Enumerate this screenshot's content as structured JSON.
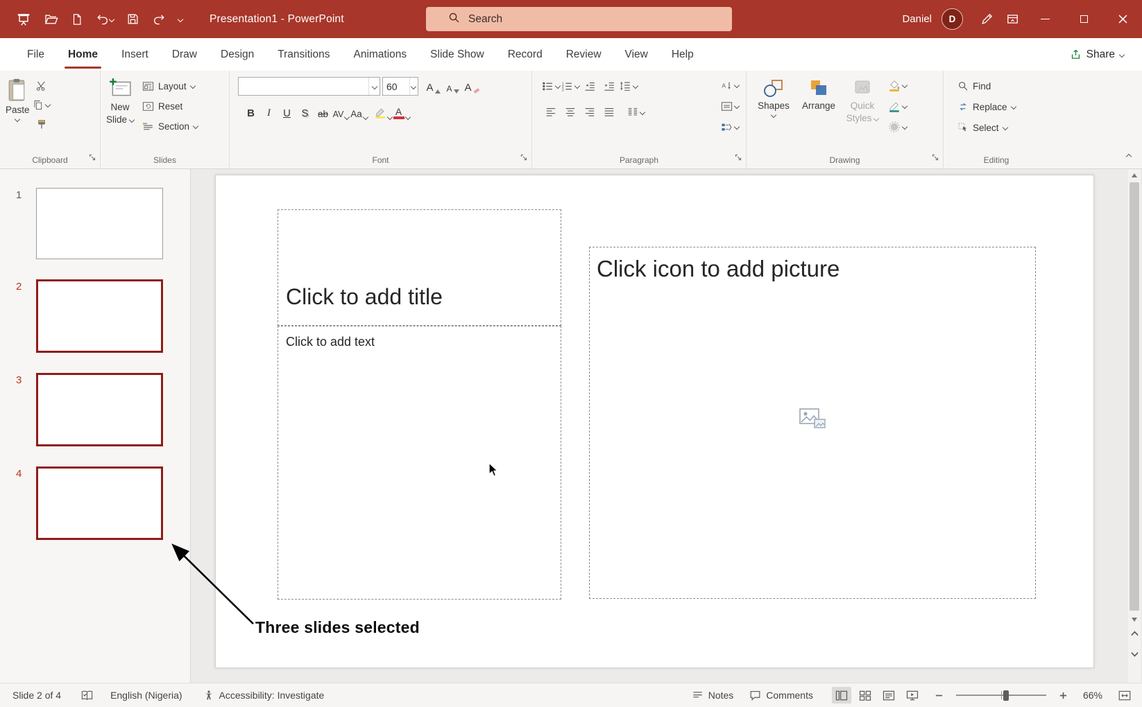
{
  "titlebar": {
    "title": "Presentation1 - PowerPoint",
    "search_placeholder": "Search",
    "user_name": "Daniel",
    "user_initial": "D"
  },
  "tabs": {
    "items": [
      {
        "label": "File"
      },
      {
        "label": "Home"
      },
      {
        "label": "Insert"
      },
      {
        "label": "Draw"
      },
      {
        "label": "Design"
      },
      {
        "label": "Transitions"
      },
      {
        "label": "Animations"
      },
      {
        "label": "Slide Show"
      },
      {
        "label": "Record"
      },
      {
        "label": "Review"
      },
      {
        "label": "View"
      },
      {
        "label": "Help"
      }
    ],
    "share_label": "Share"
  },
  "ribbon": {
    "clipboard": {
      "group_label": "Clipboard",
      "paste_label": "Paste"
    },
    "slides": {
      "group_label": "Slides",
      "new_slide_line1": "New",
      "new_slide_line2": "Slide",
      "layout_label": "Layout",
      "reset_label": "Reset",
      "section_label": "Section"
    },
    "font": {
      "group_label": "Font",
      "font_name_value": "",
      "font_size_value": "60",
      "grow_font_glyph": "A",
      "shrink_font_glyph": "A",
      "clear_format_glyph": "A",
      "bold_glyph": "B",
      "italic_glyph": "I",
      "underline_glyph": "U",
      "shadow_glyph": "S",
      "strikethrough_glyph": "ab",
      "char_spacing_glyph": "AV",
      "change_case_glyph": "Aa",
      "font_color_glyph": "A"
    },
    "paragraph": {
      "group_label": "Paragraph"
    },
    "drawing": {
      "group_label": "Drawing",
      "shapes_label": "Shapes",
      "arrange_label": "Arrange",
      "quick_styles_line1": "Quick",
      "quick_styles_line2": "Styles"
    },
    "editing": {
      "group_label": "Editing",
      "find_label": "Find",
      "replace_label": "Replace",
      "select_label": "Select"
    }
  },
  "slide_panel": {
    "slides": [
      {
        "number": "1",
        "selected": false
      },
      {
        "number": "2",
        "selected": true
      },
      {
        "number": "3",
        "selected": true
      },
      {
        "number": "4",
        "selected": true
      }
    ]
  },
  "annotation": {
    "label": "Three slides selected"
  },
  "canvas": {
    "title_placeholder": "Click to add title",
    "body_placeholder": "Click to add text",
    "picture_placeholder": "Click icon to add picture"
  },
  "status_bar": {
    "slide_indicator": "Slide 2 of 4",
    "language": "English (Nigeria)",
    "accessibility_label": "Accessibility: Investigate",
    "notes_label": "Notes",
    "comments_label": "Comments",
    "zoom_value": "66%"
  },
  "colors": {
    "titlebar_red": "#A8362A",
    "selection_border_red": "#8E1D18",
    "slide_number_red": "#C23318",
    "share_green": "#188038"
  }
}
